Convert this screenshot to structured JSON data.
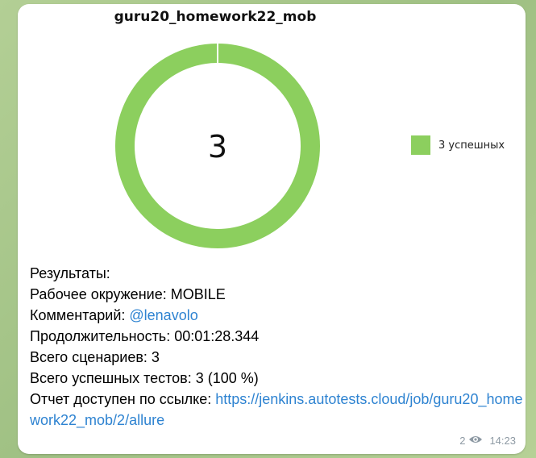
{
  "chart_data": {
    "type": "pie",
    "title": "guru20_homework22_mob",
    "center_label": "3",
    "slices": [
      {
        "label": "3 успешных",
        "value": 3,
        "color": "#8ccf5e"
      }
    ]
  },
  "message": {
    "results_heading": "Результаты:",
    "env_label": "Рабочее окружение:",
    "env_value": " MOBILE",
    "comment_label": "Комментарий:",
    "comment_mention": "@lenavolo",
    "duration_label": "Продолжительность:",
    "duration_value": " 00:01:28.344",
    "scenarios_label": "Всего сценариев:",
    "scenarios_value": " 3",
    "passed_label": "Всего успешных тестов:",
    "passed_value": " 3 (100 %)",
    "report_label": "Отчет доступен по ссылке:",
    "report_url": "https://jenkins.autotests.cloud/job/guru20_homework22_mob/2/allure"
  },
  "meta": {
    "views": "2",
    "time": "14:23",
    "views_icon": "eye-icon"
  }
}
